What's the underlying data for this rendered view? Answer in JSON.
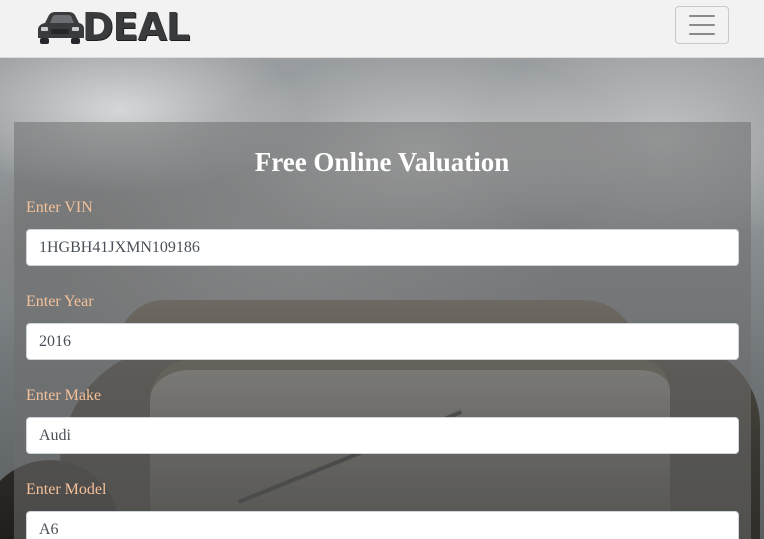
{
  "navbar": {
    "brand_text": "DEAL",
    "logo_icon": "car-icon",
    "toggler_icon": "hamburger-icon"
  },
  "form": {
    "title": "Free Online Valuation",
    "fields": [
      {
        "label": "Enter VIN",
        "value": "1HGBH41JXMN109186"
      },
      {
        "label": "Enter Year",
        "value": "2016"
      },
      {
        "label": "Enter Make",
        "value": "Audi"
      },
      {
        "label": "Enter Model",
        "value": "A6"
      }
    ]
  },
  "colors": {
    "label": "#f4c19a",
    "navbar_bg": "#f2f2f2",
    "brand": "#3a3b3d"
  }
}
